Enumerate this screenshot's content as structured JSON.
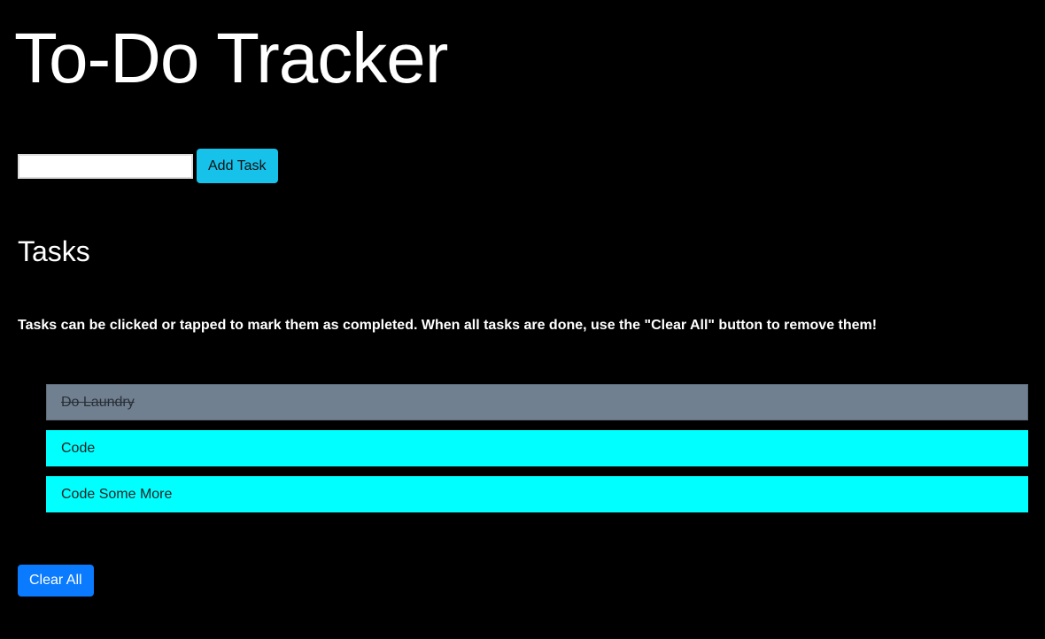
{
  "app": {
    "title": "To-Do Tracker"
  },
  "add_task": {
    "input_value": "",
    "input_placeholder": "",
    "button_label": "Add Task"
  },
  "tasks_section": {
    "heading": "Tasks",
    "hint": "Tasks can be clicked or tapped to mark them as completed. When all tasks are done, use the \"Clear All\" button to remove them!",
    "items": [
      {
        "label": "Do Laundry",
        "completed": true
      },
      {
        "label": "Code",
        "completed": false
      },
      {
        "label": "Code Some More",
        "completed": false
      }
    ]
  },
  "clear_button": {
    "label": "Clear All"
  },
  "colors": {
    "background": "#000000",
    "add_button": "#17c2ea",
    "task_pending": "#00ffff",
    "task_completed": "#708090",
    "clear_button": "#0a7bff"
  }
}
